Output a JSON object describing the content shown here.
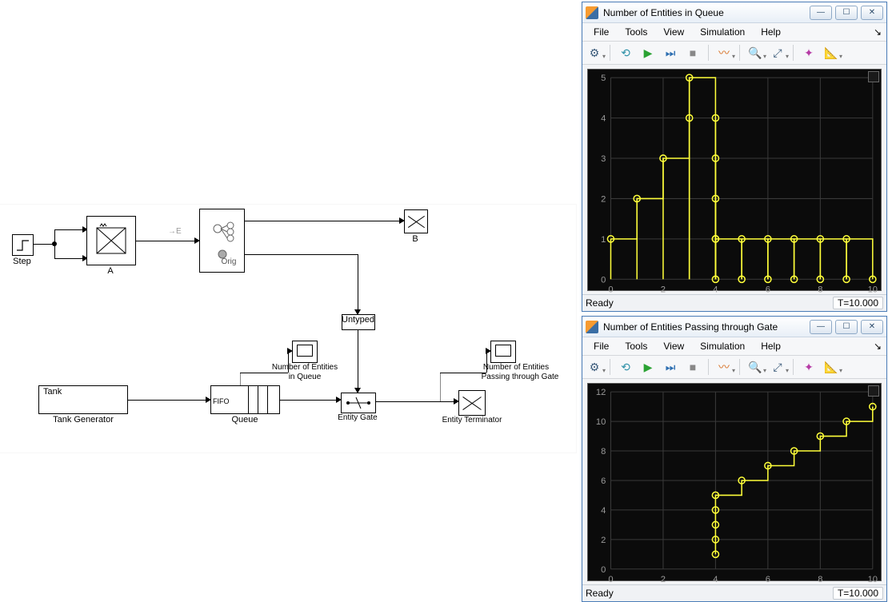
{
  "simulink": {
    "step_label": "Step",
    "A_label": "A",
    "B_label": "B",
    "orig_label": "Orig",
    "E_marker": "→E",
    "untyped_label": "Untyped",
    "tank_label": "Tank",
    "tankgen_label": "Tank Generator",
    "fifo_label": "FIFO",
    "queue_label": "Queue",
    "gate_label": "Entity Gate",
    "terminator_label": "Entity Terminator",
    "scope_q_line1": "Number of Entities",
    "scope_q_line2": "in Queue",
    "scope_g_line1": "Number of Entities",
    "scope_g_line2": "Passing through Gate"
  },
  "scope": {
    "menu": {
      "file": "File",
      "tools": "Tools",
      "view": "View",
      "simulation": "Simulation",
      "help": "Help"
    },
    "status_ready": "Ready",
    "status_time": "T=10.000",
    "win1_title": "Number of Entities in Queue",
    "win2_title": "Number of Entities Passing through Gate"
  },
  "chart_data": [
    {
      "type": "line",
      "title": "Number of Entities in Queue",
      "xlabel": "",
      "ylabel": "",
      "xlim": [
        0,
        10
      ],
      "ylim": [
        0,
        5
      ],
      "xticks": [
        0,
        2,
        4,
        6,
        8,
        10
      ],
      "yticks": [
        0,
        1,
        2,
        3,
        4,
        5
      ],
      "style": "stairs-with-stem-markers",
      "series": [
        {
          "name": "queue",
          "x": [
            0,
            1,
            2,
            3,
            3,
            4,
            4,
            4,
            4,
            4,
            4,
            5,
            5,
            6,
            6,
            7,
            7,
            8,
            8,
            9,
            9,
            10
          ],
          "values": [
            1,
            2,
            3,
            4,
            5,
            4,
            3,
            2,
            1,
            0,
            1,
            0,
            1,
            0,
            1,
            0,
            1,
            0,
            1,
            0,
            1,
            0
          ],
          "markers": [
            {
              "x": 0,
              "y": 1
            },
            {
              "x": 1,
              "y": 2
            },
            {
              "x": 2,
              "y": 3
            },
            {
              "x": 3,
              "y": 4
            },
            {
              "x": 3,
              "y": 5
            },
            {
              "x": 4,
              "y": 4
            },
            {
              "x": 4,
              "y": 3
            },
            {
              "x": 4,
              "y": 2
            },
            {
              "x": 4,
              "y": 1
            },
            {
              "x": 4,
              "y": 0
            },
            {
              "x": 4,
              "y": 1
            },
            {
              "x": 5,
              "y": 0
            },
            {
              "x": 5,
              "y": 1
            },
            {
              "x": 6,
              "y": 0
            },
            {
              "x": 6,
              "y": 1
            },
            {
              "x": 7,
              "y": 0
            },
            {
              "x": 7,
              "y": 1
            },
            {
              "x": 8,
              "y": 0
            },
            {
              "x": 8,
              "y": 1
            },
            {
              "x": 9,
              "y": 0
            },
            {
              "x": 9,
              "y": 1
            },
            {
              "x": 10,
              "y": 0
            }
          ]
        }
      ]
    },
    {
      "type": "line",
      "title": "Number of Entities Passing through Gate",
      "xlabel": "",
      "ylabel": "",
      "xlim": [
        0,
        10
      ],
      "ylim": [
        0,
        12
      ],
      "xticks": [
        0,
        2,
        4,
        6,
        8,
        10
      ],
      "yticks": [
        0,
        2,
        4,
        6,
        8,
        10,
        12
      ],
      "style": "stairs-with-markers",
      "series": [
        {
          "name": "gate",
          "x": [
            4,
            4,
            4,
            4,
            4,
            5,
            6,
            7,
            8,
            9,
            10
          ],
          "values": [
            1,
            2,
            3,
            4,
            5,
            6,
            7,
            8,
            9,
            10,
            11
          ],
          "markers": [
            {
              "x": 4,
              "y": 1
            },
            {
              "x": 4,
              "y": 2
            },
            {
              "x": 4,
              "y": 3
            },
            {
              "x": 4,
              "y": 4
            },
            {
              "x": 4,
              "y": 5
            },
            {
              "x": 5,
              "y": 6
            },
            {
              "x": 6,
              "y": 7
            },
            {
              "x": 7,
              "y": 8
            },
            {
              "x": 8,
              "y": 9
            },
            {
              "x": 9,
              "y": 10
            },
            {
              "x": 10,
              "y": 11
            }
          ]
        }
      ]
    }
  ]
}
